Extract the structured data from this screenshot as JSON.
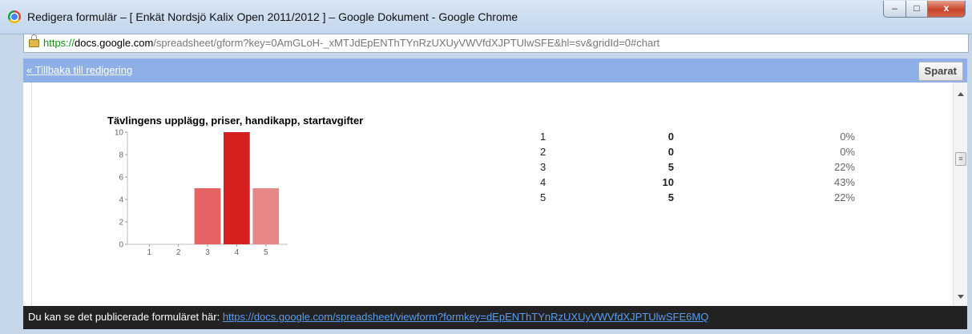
{
  "window": {
    "title": "Redigera formulär – [ Enkät Nordsjö Kalix Open 2011/2012 ] – Google Dokument - Google Chrome",
    "minimize_glyph": "–",
    "maximize_glyph": "□",
    "close_glyph": "x"
  },
  "address_bar": {
    "scheme": "https://",
    "host": "docs.google.com",
    "path": "/spreadsheet/gform?key=0AmGLoH-_xMTJdEpENThTYnRzUXUyVWVfdXJPTUlwSFE&hl=sv&gridId=0#chart"
  },
  "toolbar": {
    "back_link": "« Tillbaka till redigering",
    "saved_label": "Sparat"
  },
  "scroll": {
    "thumb_glyph": "≡"
  },
  "chart_data": {
    "type": "bar",
    "title": "Tävlingens upplägg, priser, handikapp, startavgifter",
    "xlabel": "",
    "ylabel": "",
    "categories": [
      "1",
      "2",
      "3",
      "4",
      "5"
    ],
    "values": [
      0,
      0,
      5,
      10,
      5
    ],
    "ylim": [
      0,
      10
    ],
    "yticks": [
      "0",
      "2",
      "4",
      "6",
      "8",
      "10"
    ],
    "colors": [
      "#e46262",
      "#e46262",
      "#e46262",
      "#d62020",
      "#e88787"
    ]
  },
  "summary_table": [
    {
      "category": "1",
      "count": "0",
      "percent": "0%"
    },
    {
      "category": "2",
      "count": "0",
      "percent": "0%"
    },
    {
      "category": "3",
      "count": "5",
      "percent": "22%"
    },
    {
      "category": "4",
      "count": "10",
      "percent": "43%"
    },
    {
      "category": "5",
      "count": "5",
      "percent": "22%"
    }
  ],
  "footer": {
    "text": "Du kan se det publicerade formuläret här:",
    "link": "https://docs.google.com/spreadsheet/viewform?formkey=dEpENThTYnRzUXUyVWVfdXJPTUlwSFE6MQ"
  }
}
